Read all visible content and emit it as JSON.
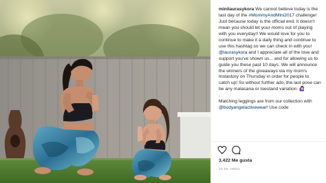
{
  "post": {
    "photo_alt": "",
    "caption": {
      "username": "minilaurasykora",
      "line_1": " We cannot believe today is the last day of the ",
      "hashtag": "#MommyAndMini2017",
      "line_2": " challenge! Just because today is the official end, it doesn't mean you should let your moms out of playing with you everyday!! We would love for you to continue to make it a daily thing and continue to use this hashtag so we can check in with you! ",
      "mention_1": "@laurasykora",
      "line_3": " and I appreciate all of the love and support you've shown us... and for allowing us to guide you these past 10 days. We will announce the winners of the giveaways via my mom's Instastory on Thursday in order for people to catch up! So without further ado, the last pose can be any malasana or toestand variation. ",
      "emoji_1": "🙋🏻‍♀️",
      "dot": ".",
      "line_4": "Matching leggings are from our collection with ",
      "mention_2": "@bodyangelactivewear",
      "line_5": "! Use code"
    },
    "likes": "3.422 Me gusta",
    "date": "30 DE ABRIL"
  },
  "colors": {
    "text": "#262626",
    "link": "#003569",
    "muted": "#999999"
  },
  "icons": [
    "heart-icon",
    "comment-icon"
  ]
}
